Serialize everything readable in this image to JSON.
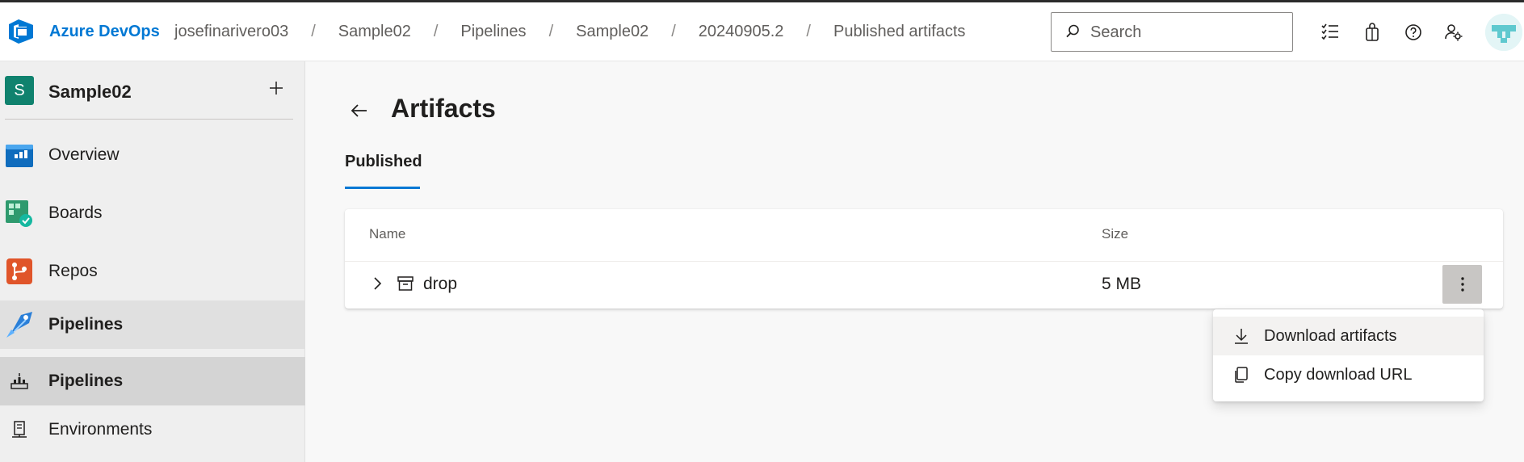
{
  "header": {
    "brand": "Azure DevOps",
    "breadcrumbs": [
      "josefinarivero03",
      "Sample02",
      "Pipelines",
      "Sample02",
      "20240905.2",
      "Published artifacts"
    ],
    "separator": "/",
    "search": {
      "placeholder": "Search",
      "value": ""
    },
    "icons": [
      "task-list-icon",
      "shopping-bag-icon",
      "help-icon",
      "user-settings-icon"
    ]
  },
  "sidebar": {
    "project_initial": "S",
    "project_name": "Sample02",
    "items": [
      {
        "label": "Overview",
        "icon": "overview-icon"
      },
      {
        "label": "Boards",
        "icon": "boards-icon"
      },
      {
        "label": "Repos",
        "icon": "repos-icon"
      },
      {
        "label": "Pipelines",
        "icon": "pipelines-icon"
      },
      {
        "label": "Pipelines",
        "icon": "pipelines-sub-icon"
      },
      {
        "label": "Environments",
        "icon": "environments-icon"
      }
    ]
  },
  "main": {
    "title": "Artifacts",
    "tabs": [
      {
        "label": "Published"
      }
    ],
    "table": {
      "columns": [
        "Name",
        "Size"
      ],
      "rows": [
        {
          "name": "drop",
          "size": "5 MB"
        }
      ]
    },
    "context_menu": {
      "items": [
        {
          "label": "Download artifacts",
          "icon": "download-icon"
        },
        {
          "label": "Copy download URL",
          "icon": "copy-icon"
        }
      ]
    }
  },
  "colors": {
    "accent": "#0078d4",
    "project_badge": "#10826e"
  }
}
